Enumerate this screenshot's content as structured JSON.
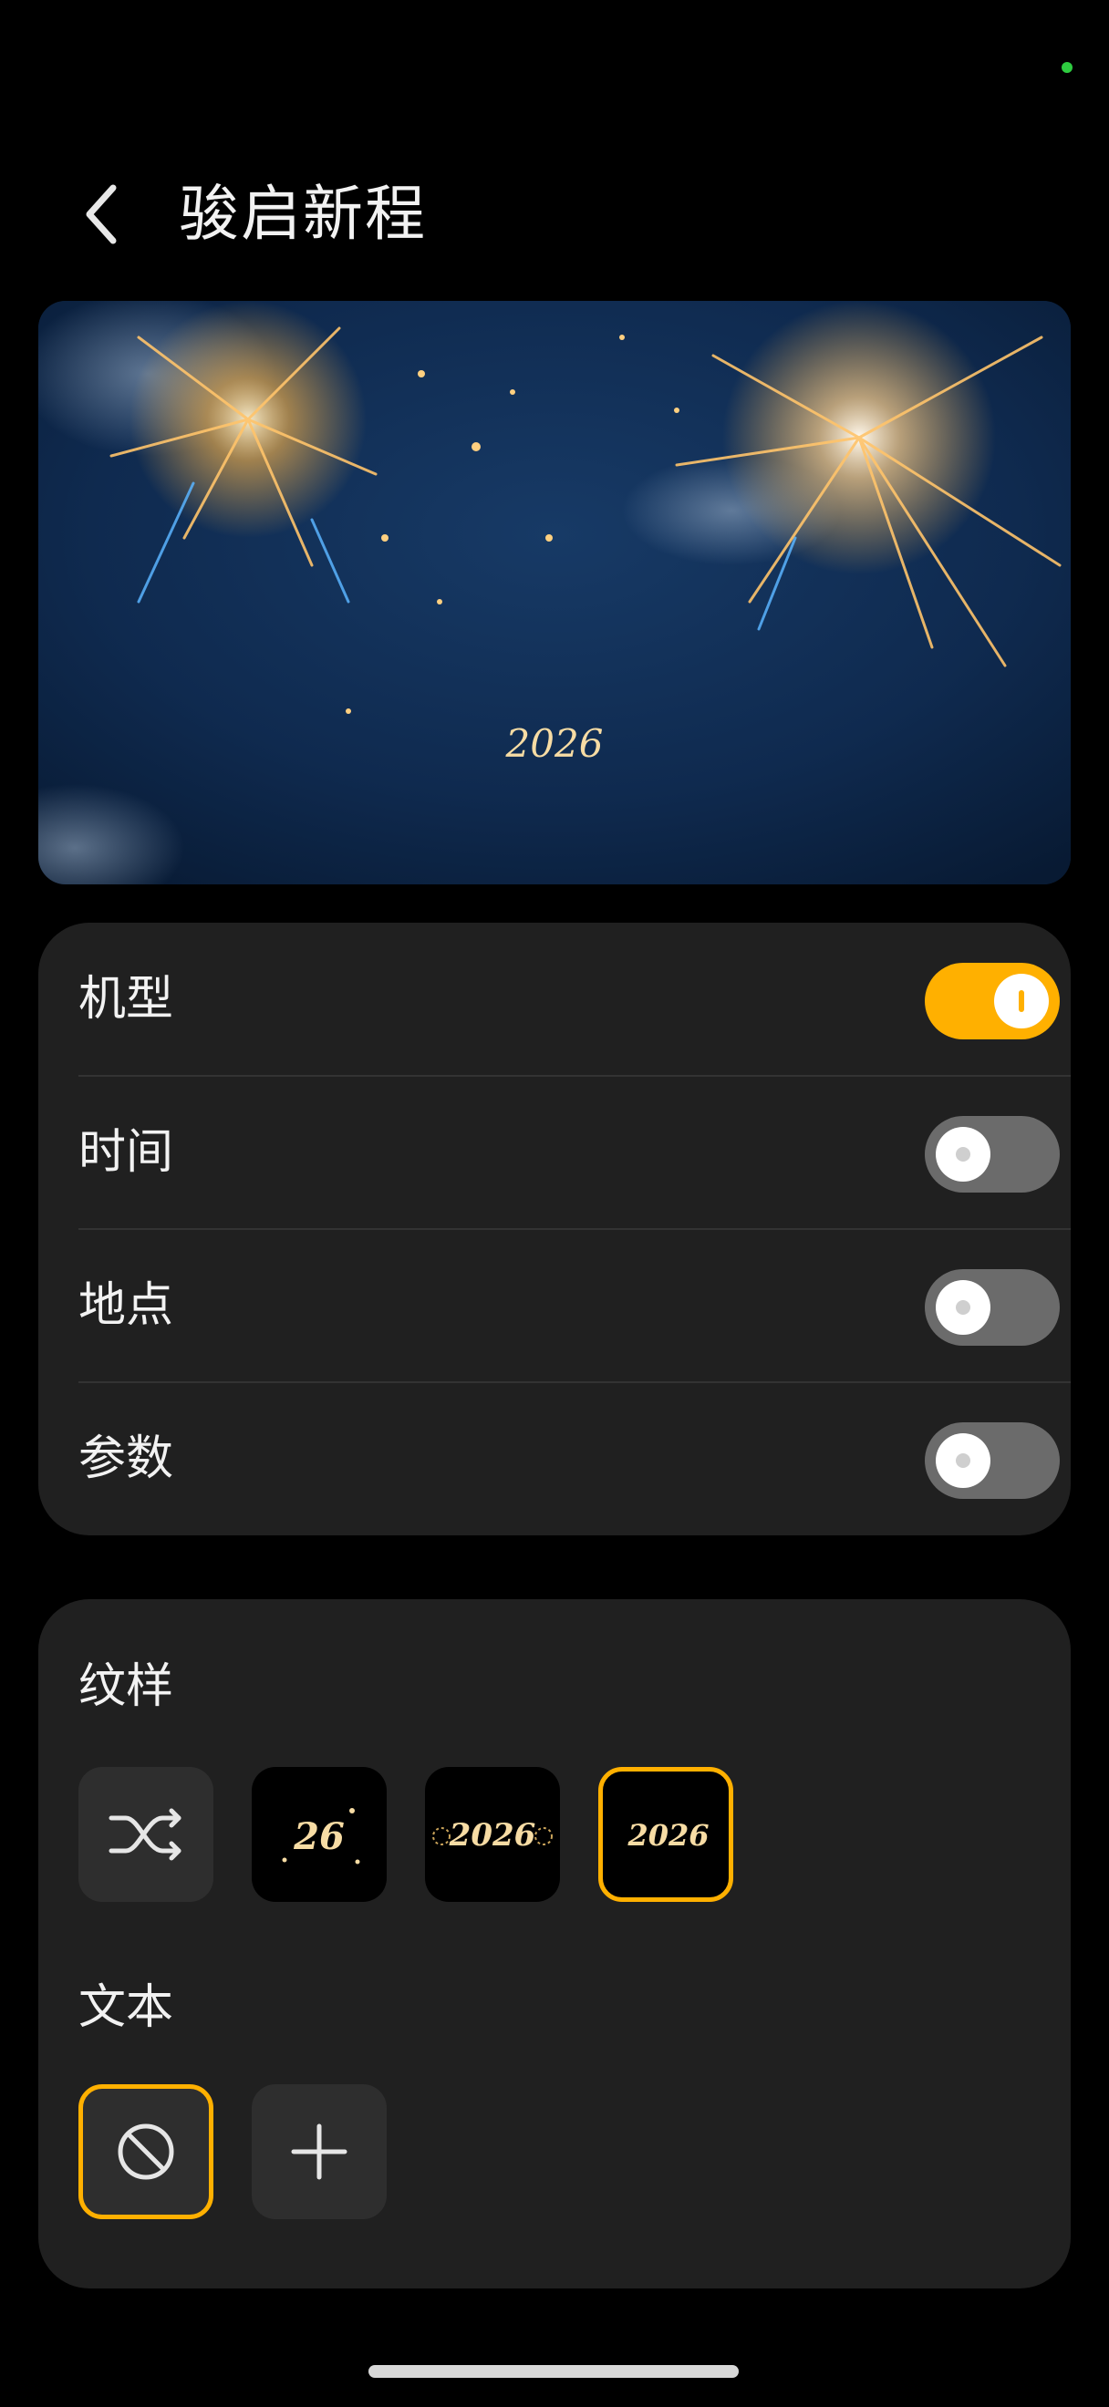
{
  "header": {
    "title": "骏启新程"
  },
  "preview": {
    "watermark_text": "2026"
  },
  "toggles": [
    {
      "label": "机型",
      "on": true
    },
    {
      "label": "时间",
      "on": false
    },
    {
      "label": "地点",
      "on": false
    },
    {
      "label": "参数",
      "on": false
    }
  ],
  "pattern": {
    "label": "纹样",
    "options": [
      {
        "icon": "shuffle-icon",
        "selected": false
      },
      {
        "text": "26",
        "selected": false
      },
      {
        "text": "2026",
        "selected": false
      },
      {
        "text": "2026",
        "selected": true
      }
    ]
  },
  "text": {
    "label": "文本",
    "options": [
      {
        "icon": "none-icon",
        "selected": true
      },
      {
        "icon": "plus-icon",
        "selected": false
      }
    ]
  },
  "colors": {
    "accent": "#ffb000",
    "card": "#202020",
    "toggle_off": "#6b6b6b"
  }
}
